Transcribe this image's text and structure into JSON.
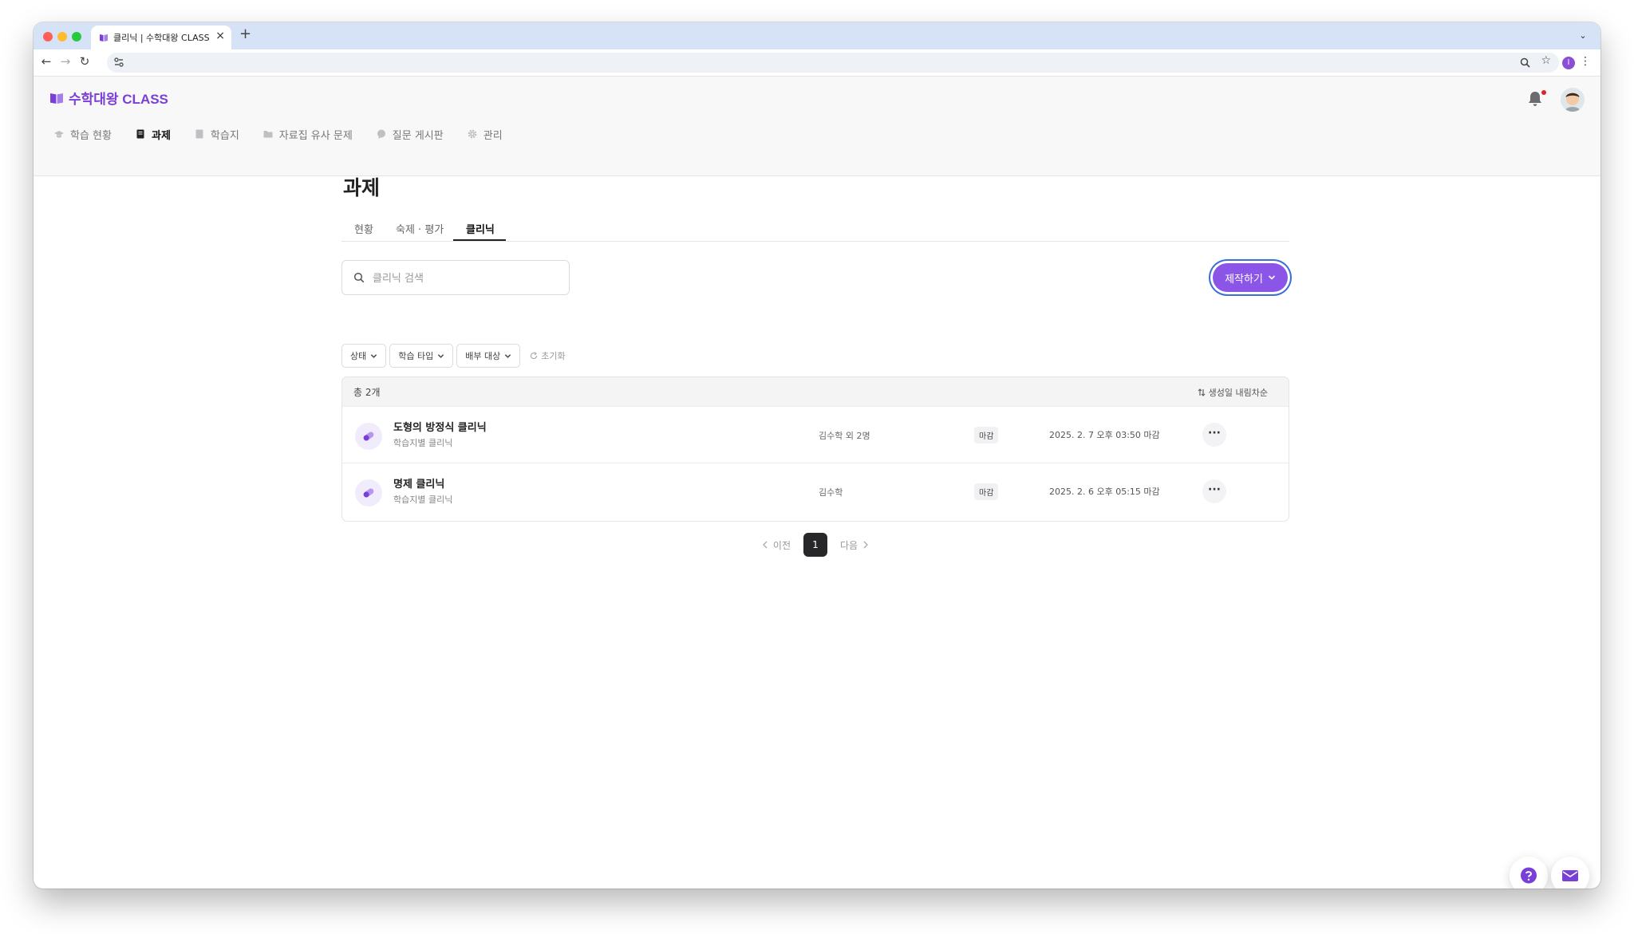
{
  "browser": {
    "tab_title": "클리닉 | 수학대왕 CLASS",
    "tab_close": "×",
    "new_tab": "+",
    "tab_menu": "⌄",
    "profile_initial": "I"
  },
  "app": {
    "logo": "수학대왕 CLASS",
    "nav": [
      {
        "label": "학습 현황",
        "icon": "graduation-cap-icon"
      },
      {
        "label": "과제",
        "icon": "assignment-icon"
      },
      {
        "label": "학습지",
        "icon": "worksheet-icon"
      },
      {
        "label": "자료집 유사 문제",
        "icon": "folder-icon"
      },
      {
        "label": "질문 게시판",
        "icon": "chat-bubble-icon"
      },
      {
        "label": "관리",
        "icon": "gear-icon"
      }
    ],
    "accent_color": "#8b55e8"
  },
  "page": {
    "title": "과제",
    "subtabs": [
      "현황",
      "숙제 · 평가",
      "클리닉"
    ],
    "active_subtab": "클리닉",
    "search": {
      "placeholder": "클리닉 검색",
      "value": ""
    },
    "create_button": "제작하기",
    "filters": [
      "상태",
      "학습 타입",
      "배부 대상"
    ],
    "reset_label": "초기화",
    "total": "총 2개",
    "sort_label": "생성일 내림차순",
    "rows": [
      {
        "title": "도형의 방정식 클리닉",
        "subtitle": "학습지별 클리닉",
        "assignee": "김수학 외 2명",
        "status": "마감",
        "deadline": "2025. 2. 7 오후 03:50 마감"
      },
      {
        "title": "명제 클리닉",
        "subtitle": "학습지별 클리닉",
        "assignee": "김수학",
        "status": "마감",
        "deadline": "2025. 2. 6 오후 05:15 마감"
      }
    ],
    "pagination": {
      "prev": "이전",
      "current": "1",
      "next": "다음"
    }
  }
}
